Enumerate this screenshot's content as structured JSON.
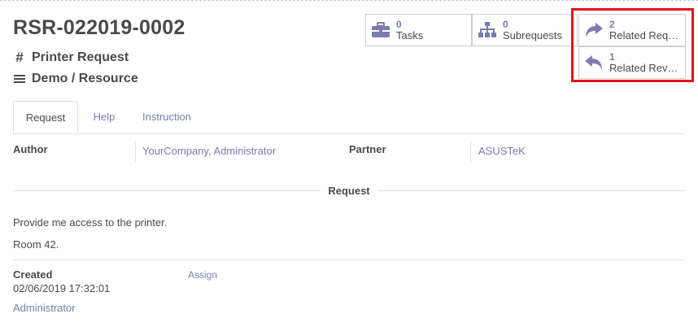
{
  "record": {
    "title": "RSR-022019-0002",
    "type": "Printer Request",
    "category": "Demo / Resource"
  },
  "stats": {
    "tasks": {
      "count": "0",
      "label": "Tasks"
    },
    "subrequests": {
      "count": "0",
      "label": "Subrequests"
    },
    "related_requests": {
      "count": "2",
      "label": "Related Requests"
    },
    "related_reverse": {
      "count": "1",
      "label": "Related Reverse"
    }
  },
  "tabs": [
    {
      "label": "Request"
    },
    {
      "label": "Help"
    },
    {
      "label": "Instruction"
    }
  ],
  "fields": {
    "author_label": "Author",
    "author_value": "YourCompany, Administrator",
    "partner_label": "Partner",
    "partner_value": "ASUSTeK"
  },
  "request_section": {
    "title": "Request",
    "lines": [
      "Provide me access to the printer.",
      "Room 42."
    ]
  },
  "footer": {
    "created_label": "Created",
    "created_date": "02/06/2019 17:32:01",
    "created_by": "Administrator",
    "assign_label": "Assign"
  },
  "colors": {
    "accent": "#7c7bad",
    "highlight": "#e8121b",
    "text": "#4a4a4a"
  }
}
